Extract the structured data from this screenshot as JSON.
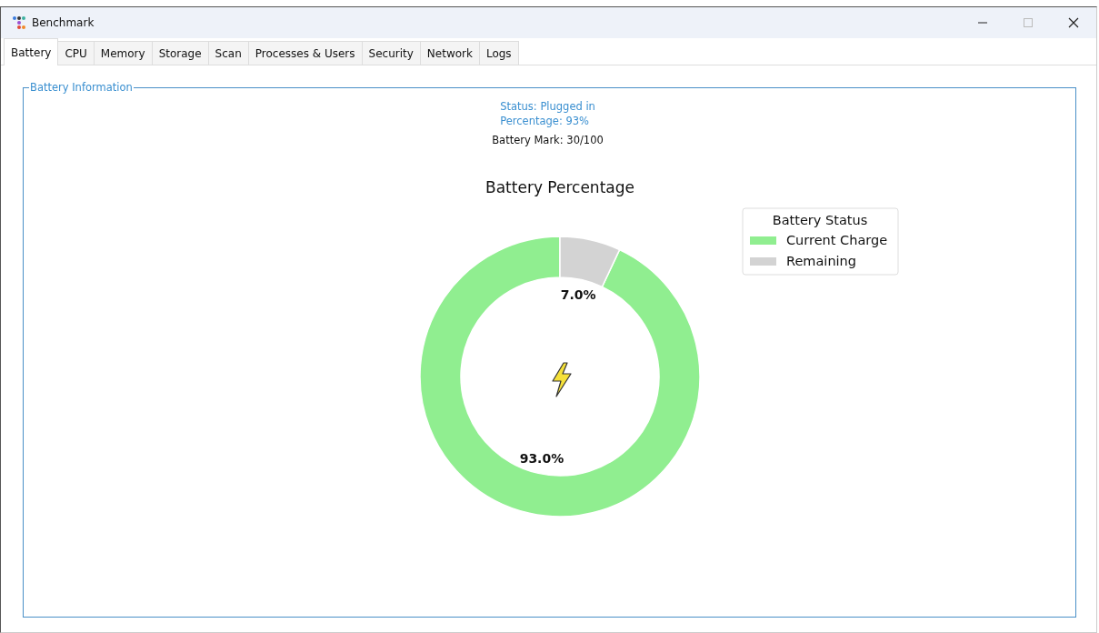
{
  "window": {
    "title": "Benchmark"
  },
  "tabs": [
    {
      "label": "Battery",
      "selected": true
    },
    {
      "label": "CPU",
      "selected": false
    },
    {
      "label": "Memory",
      "selected": false
    },
    {
      "label": "Storage",
      "selected": false
    },
    {
      "label": "Scan",
      "selected": false
    },
    {
      "label": "Processes & Users",
      "selected": false
    },
    {
      "label": "Security",
      "selected": false
    },
    {
      "label": "Network",
      "selected": false
    },
    {
      "label": "Logs",
      "selected": false
    }
  ],
  "battery_info": {
    "title": "Battery Information",
    "status": "Status: Plugged in",
    "percentage": "Percentage: 93%",
    "mark": "Battery Mark: 30/100",
    "chart_data": {
      "type": "donut",
      "title": "Battery Percentage",
      "categories": [
        "Current Charge",
        "Remaining"
      ],
      "series": [
        {
          "name": "Battery Status",
          "colors": [
            "#90ee90",
            "#d3d3d3"
          ],
          "values": [
            93.0,
            7.0
          ]
        }
      ],
      "value_labels": [
        "93.0%",
        "7.0%"
      ],
      "legend": "upper right"
    }
  }
}
